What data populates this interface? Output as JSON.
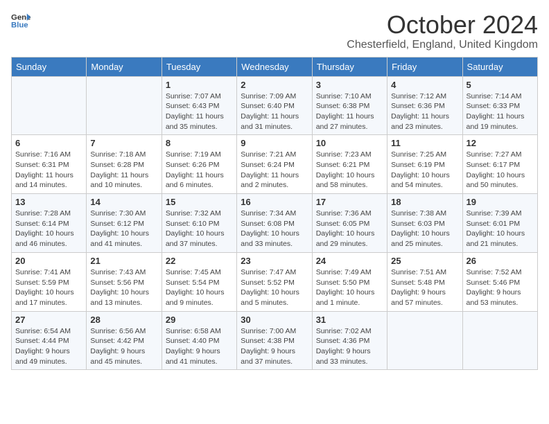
{
  "header": {
    "logo_general": "General",
    "logo_blue": "Blue",
    "month_title": "October 2024",
    "location": "Chesterfield, England, United Kingdom"
  },
  "days_of_week": [
    "Sunday",
    "Monday",
    "Tuesday",
    "Wednesday",
    "Thursday",
    "Friday",
    "Saturday"
  ],
  "weeks": [
    [
      {
        "day": "",
        "info": ""
      },
      {
        "day": "",
        "info": ""
      },
      {
        "day": "1",
        "info": "Sunrise: 7:07 AM\nSunset: 6:43 PM\nDaylight: 11 hours and 35 minutes."
      },
      {
        "day": "2",
        "info": "Sunrise: 7:09 AM\nSunset: 6:40 PM\nDaylight: 11 hours and 31 minutes."
      },
      {
        "day": "3",
        "info": "Sunrise: 7:10 AM\nSunset: 6:38 PM\nDaylight: 11 hours and 27 minutes."
      },
      {
        "day": "4",
        "info": "Sunrise: 7:12 AM\nSunset: 6:36 PM\nDaylight: 11 hours and 23 minutes."
      },
      {
        "day": "5",
        "info": "Sunrise: 7:14 AM\nSunset: 6:33 PM\nDaylight: 11 hours and 19 minutes."
      }
    ],
    [
      {
        "day": "6",
        "info": "Sunrise: 7:16 AM\nSunset: 6:31 PM\nDaylight: 11 hours and 14 minutes."
      },
      {
        "day": "7",
        "info": "Sunrise: 7:18 AM\nSunset: 6:28 PM\nDaylight: 11 hours and 10 minutes."
      },
      {
        "day": "8",
        "info": "Sunrise: 7:19 AM\nSunset: 6:26 PM\nDaylight: 11 hours and 6 minutes."
      },
      {
        "day": "9",
        "info": "Sunrise: 7:21 AM\nSunset: 6:24 PM\nDaylight: 11 hours and 2 minutes."
      },
      {
        "day": "10",
        "info": "Sunrise: 7:23 AM\nSunset: 6:21 PM\nDaylight: 10 hours and 58 minutes."
      },
      {
        "day": "11",
        "info": "Sunrise: 7:25 AM\nSunset: 6:19 PM\nDaylight: 10 hours and 54 minutes."
      },
      {
        "day": "12",
        "info": "Sunrise: 7:27 AM\nSunset: 6:17 PM\nDaylight: 10 hours and 50 minutes."
      }
    ],
    [
      {
        "day": "13",
        "info": "Sunrise: 7:28 AM\nSunset: 6:14 PM\nDaylight: 10 hours and 46 minutes."
      },
      {
        "day": "14",
        "info": "Sunrise: 7:30 AM\nSunset: 6:12 PM\nDaylight: 10 hours and 41 minutes."
      },
      {
        "day": "15",
        "info": "Sunrise: 7:32 AM\nSunset: 6:10 PM\nDaylight: 10 hours and 37 minutes."
      },
      {
        "day": "16",
        "info": "Sunrise: 7:34 AM\nSunset: 6:08 PM\nDaylight: 10 hours and 33 minutes."
      },
      {
        "day": "17",
        "info": "Sunrise: 7:36 AM\nSunset: 6:05 PM\nDaylight: 10 hours and 29 minutes."
      },
      {
        "day": "18",
        "info": "Sunrise: 7:38 AM\nSunset: 6:03 PM\nDaylight: 10 hours and 25 minutes."
      },
      {
        "day": "19",
        "info": "Sunrise: 7:39 AM\nSunset: 6:01 PM\nDaylight: 10 hours and 21 minutes."
      }
    ],
    [
      {
        "day": "20",
        "info": "Sunrise: 7:41 AM\nSunset: 5:59 PM\nDaylight: 10 hours and 17 minutes."
      },
      {
        "day": "21",
        "info": "Sunrise: 7:43 AM\nSunset: 5:56 PM\nDaylight: 10 hours and 13 minutes."
      },
      {
        "day": "22",
        "info": "Sunrise: 7:45 AM\nSunset: 5:54 PM\nDaylight: 10 hours and 9 minutes."
      },
      {
        "day": "23",
        "info": "Sunrise: 7:47 AM\nSunset: 5:52 PM\nDaylight: 10 hours and 5 minutes."
      },
      {
        "day": "24",
        "info": "Sunrise: 7:49 AM\nSunset: 5:50 PM\nDaylight: 10 hours and 1 minute."
      },
      {
        "day": "25",
        "info": "Sunrise: 7:51 AM\nSunset: 5:48 PM\nDaylight: 9 hours and 57 minutes."
      },
      {
        "day": "26",
        "info": "Sunrise: 7:52 AM\nSunset: 5:46 PM\nDaylight: 9 hours and 53 minutes."
      }
    ],
    [
      {
        "day": "27",
        "info": "Sunrise: 6:54 AM\nSunset: 4:44 PM\nDaylight: 9 hours and 49 minutes."
      },
      {
        "day": "28",
        "info": "Sunrise: 6:56 AM\nSunset: 4:42 PM\nDaylight: 9 hours and 45 minutes."
      },
      {
        "day": "29",
        "info": "Sunrise: 6:58 AM\nSunset: 4:40 PM\nDaylight: 9 hours and 41 minutes."
      },
      {
        "day": "30",
        "info": "Sunrise: 7:00 AM\nSunset: 4:38 PM\nDaylight: 9 hours and 37 minutes."
      },
      {
        "day": "31",
        "info": "Sunrise: 7:02 AM\nSunset: 4:36 PM\nDaylight: 9 hours and 33 minutes."
      },
      {
        "day": "",
        "info": ""
      },
      {
        "day": "",
        "info": ""
      }
    ]
  ]
}
